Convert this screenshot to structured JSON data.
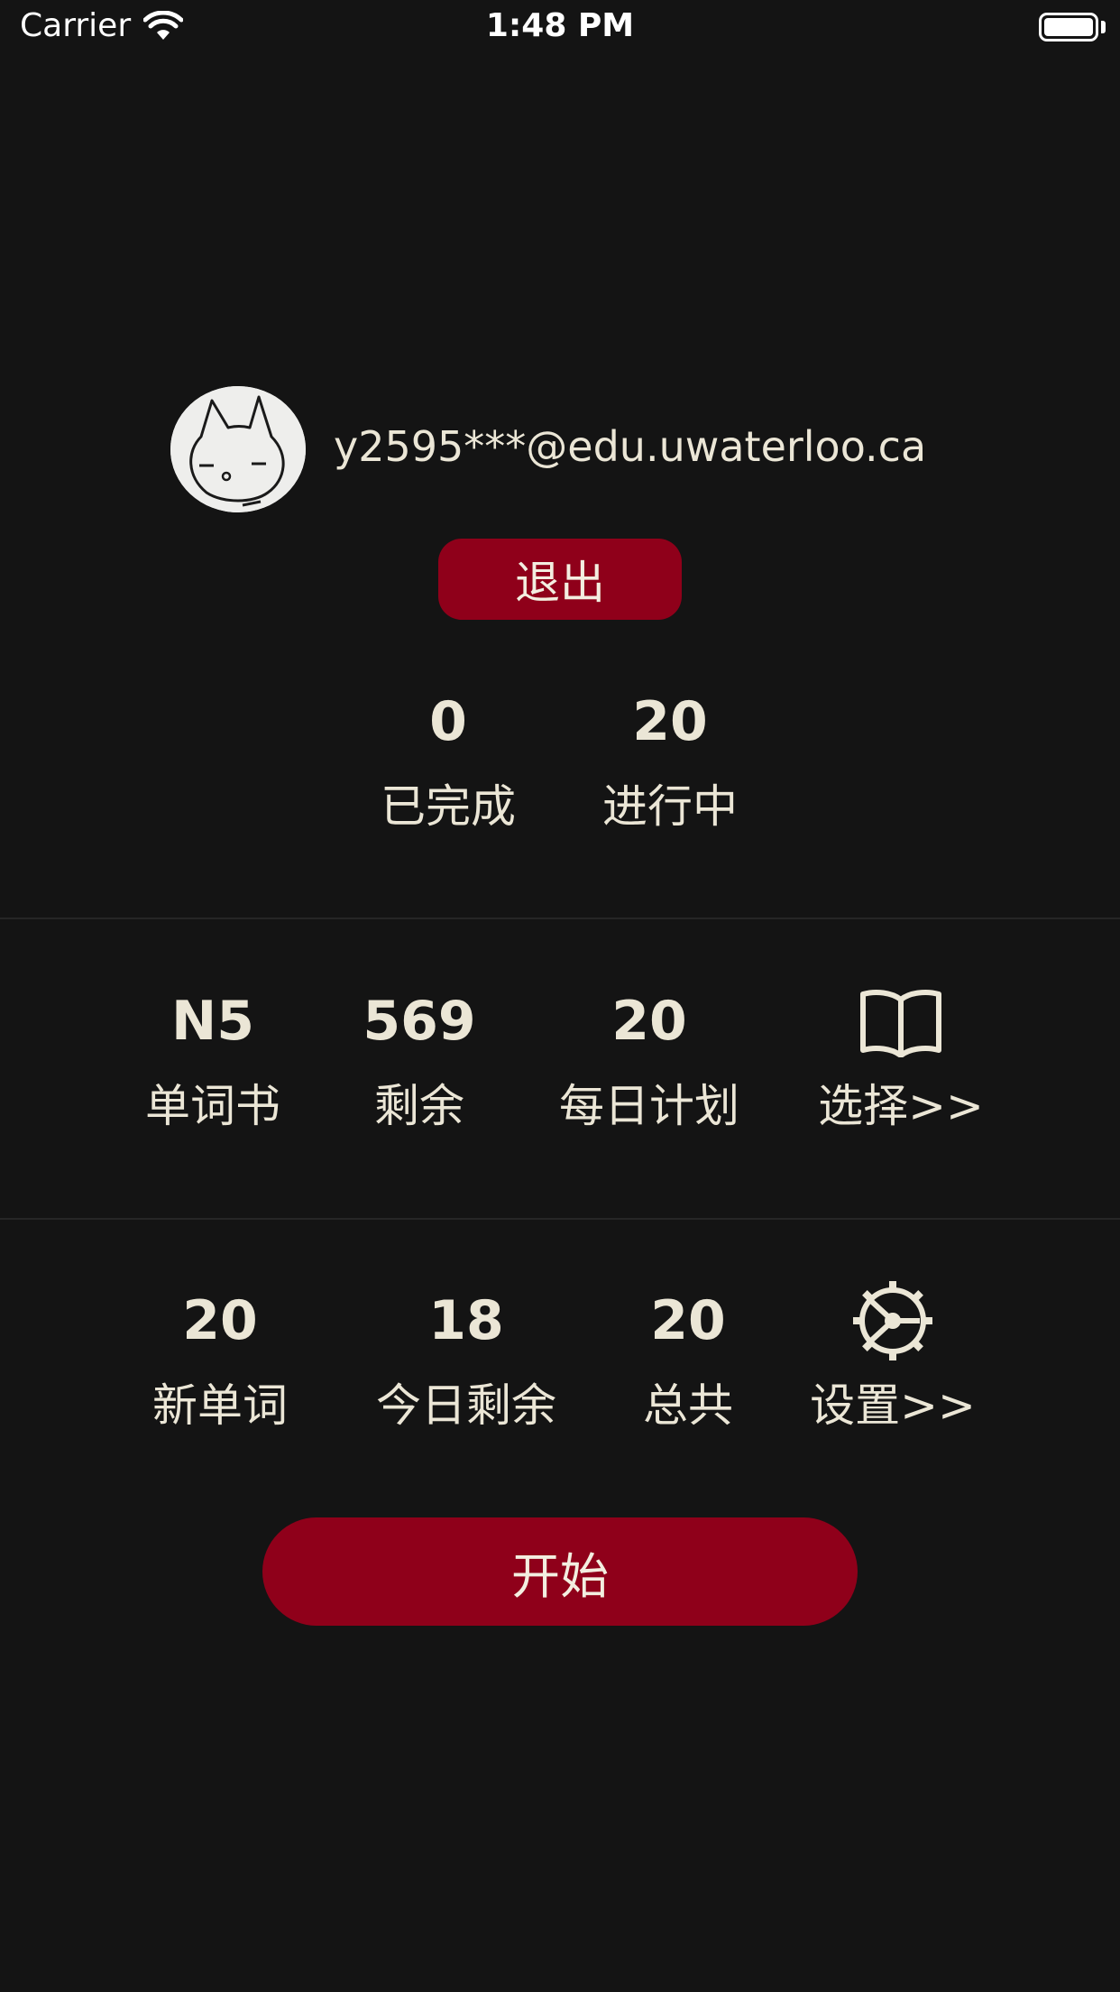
{
  "status_bar": {
    "carrier": "Carrier",
    "time": "1:48 PM"
  },
  "profile": {
    "email": "y2595***@edu.uwaterloo.ca",
    "logout_label": "退出"
  },
  "progress": {
    "completed_value": "0",
    "completed_label": "已完成",
    "in_progress_value": "20",
    "in_progress_label": "进行中"
  },
  "book": {
    "name_value": "N5",
    "name_label": "单词书",
    "remaining_value": "569",
    "remaining_label": "剩余",
    "daily_plan_value": "20",
    "daily_plan_label": "每日计划",
    "select_icon": "book-open-icon",
    "select_label": "选择>>"
  },
  "today": {
    "new_words_value": "20",
    "new_words_label": "新单词",
    "today_remaining_value": "18",
    "today_remaining_label": "今日剩余",
    "total_value": "20",
    "total_label": "总共",
    "settings_icon": "gear-icon",
    "settings_label": "设置>>"
  },
  "start_label": "开始",
  "colors": {
    "background": "#141414",
    "accent": "#8f001a",
    "text": "#ebe6d6"
  }
}
